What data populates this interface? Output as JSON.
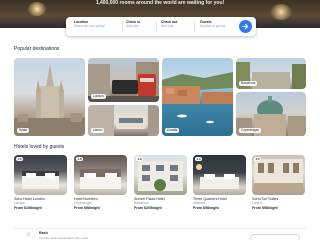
{
  "hero": {
    "tagline": "1,400,000 rooms around the world are waiting for you!"
  },
  "search": {
    "fields": [
      {
        "label": "Location",
        "value": "Where are you going?"
      },
      {
        "label": "Check in",
        "value": "Add date"
      },
      {
        "label": "Check out",
        "value": "Add date"
      },
      {
        "label": "Guests",
        "value": "Number of guests"
      }
    ],
    "button_icon": "search-icon"
  },
  "destinations": {
    "title": "Popular destinations",
    "items": [
      {
        "name": "Spain"
      },
      {
        "name": "London"
      },
      {
        "name": "Lisbon"
      },
      {
        "name": "Croatia"
      },
      {
        "name": "Barcelona"
      },
      {
        "name": "Copenhagen"
      }
    ]
  },
  "hotels": {
    "title": "Hotels loved by guests",
    "items": [
      {
        "badge": "4.6",
        "name": "Soho Hotel London",
        "city": "London",
        "price": "From $198/night"
      },
      {
        "badge": "4.6",
        "name": "Hotel Norrebro",
        "city": "Copenhagen",
        "price": "From $98/night"
      },
      {
        "badge": "4.8",
        "name": "Sunset Plaza Hotel",
        "city": "Barcelona",
        "price": "From $205/night"
      },
      {
        "badge": "4.6",
        "name": "Three Quarters Hotel",
        "city": "Valencia",
        "price": "From $98/night"
      },
      {
        "badge": "4.5",
        "name": "SoHoTurf Suites",
        "city": "London",
        "price": "From $98/night"
      }
    ]
  },
  "footer": {
    "title": "Rash",
    "subtitle": "Find the best hotel deals in the world",
    "button_label": ""
  },
  "colors": {
    "accent": "#2f7bf3",
    "text": "#1c2233",
    "muted": "#8a919c"
  }
}
